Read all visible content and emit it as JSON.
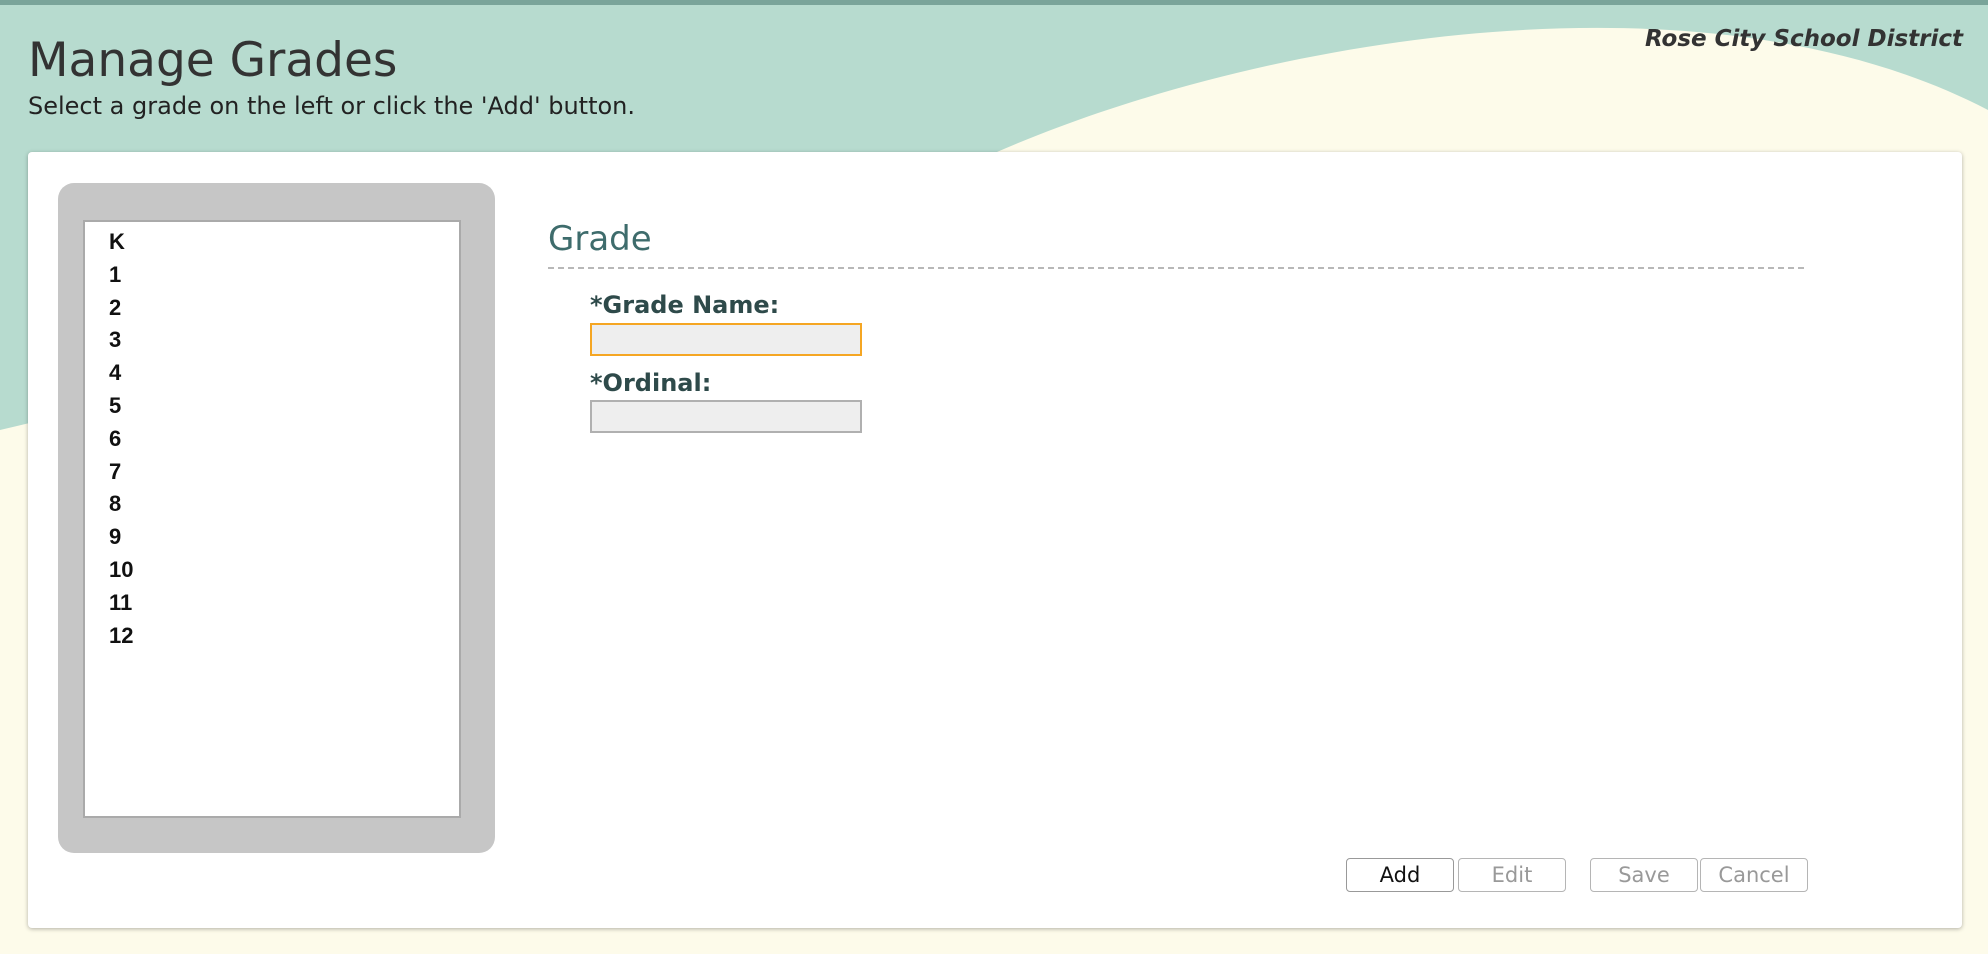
{
  "header": {
    "title": "Manage Grades",
    "subtitle": "Select a grade on the left or click the 'Add' button.",
    "district": "Rose City School District"
  },
  "grades": [
    "K",
    "1",
    "2",
    "3",
    "4",
    "5",
    "6",
    "7",
    "8",
    "9",
    "10",
    "11",
    "12"
  ],
  "form": {
    "section_title": "Grade",
    "grade_name_label": "*Grade Name:",
    "grade_name_value": "",
    "ordinal_label": "*Ordinal:",
    "ordinal_value": ""
  },
  "buttons": {
    "add": "Add",
    "edit": "Edit",
    "save": "Save",
    "cancel": "Cancel"
  },
  "colors": {
    "header_band": "#b7dbcf",
    "page_background": "#fdfbea",
    "section_title": "#3e6c6c",
    "focus_border": "#f5a623"
  }
}
